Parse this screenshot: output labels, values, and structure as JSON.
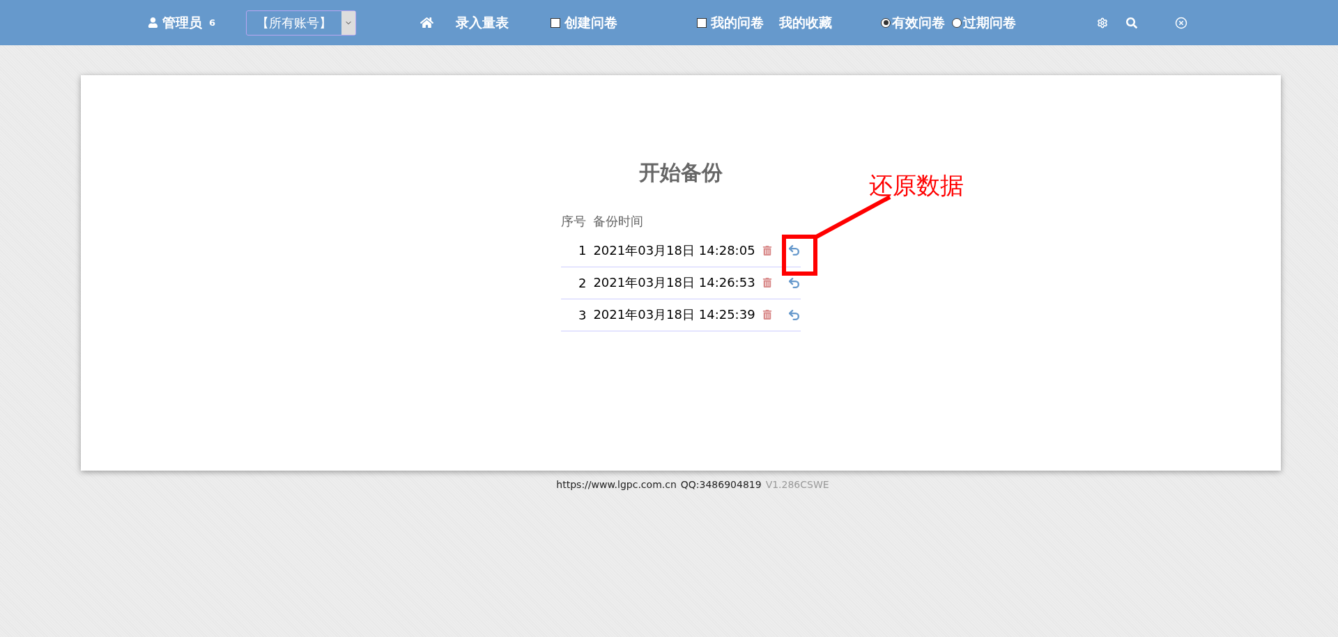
{
  "navbar": {
    "items": [
      {
        "kind": "user",
        "label": "管理员",
        "badge": "6"
      },
      {
        "kind": "select",
        "label": "【所有账号】"
      },
      {
        "kind": "home"
      },
      {
        "kind": "link",
        "label": "录入量表"
      },
      {
        "kind": "checkbox",
        "label": "创建问卷",
        "checked": false
      },
      {
        "kind": "checkbox",
        "label": "我的问卷",
        "checked": false
      },
      {
        "kind": "link",
        "label": "我的收藏"
      },
      {
        "kind": "radio",
        "label": "有效问卷",
        "selected": true
      },
      {
        "kind": "radio",
        "label": "过期问卷",
        "selected": false
      },
      {
        "kind": "settings"
      },
      {
        "kind": "search"
      },
      {
        "kind": "close"
      }
    ]
  },
  "card": {
    "title": "开始备份",
    "table": {
      "columns": [
        "序号",
        "备份时间"
      ],
      "rows": [
        {
          "index": "1",
          "time": "2021年03月18日 14:28:05"
        },
        {
          "index": "2",
          "time": "2021年03月18日 14:26:53"
        },
        {
          "index": "3",
          "time": "2021年03月18日 14:25:39"
        }
      ]
    },
    "annotation": {
      "label": "还原数据"
    }
  },
  "footer": {
    "site": "https://www.lgpc.com.cn",
    "qq": "QQ:3486904819",
    "version": "V1.286CSWE"
  }
}
